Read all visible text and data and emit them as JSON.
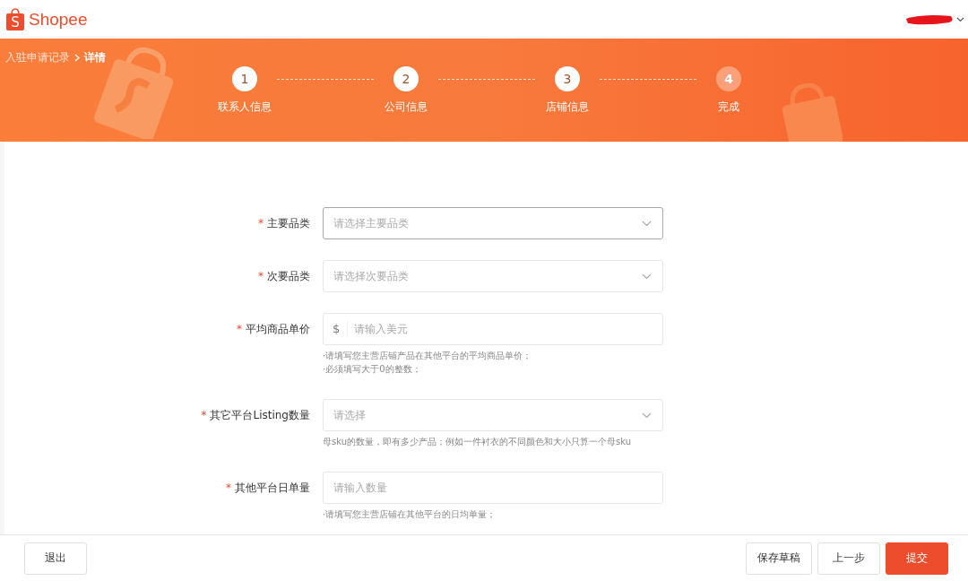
{
  "header": {
    "logo": {
      "mark": "S",
      "name": "Shopee"
    }
  },
  "breadcrumb": [
    {
      "label": "入驻申请记录",
      "current": false
    },
    {
      "label": "详情",
      "current": true
    }
  ],
  "steps": [
    {
      "number": "1",
      "label": "联系人信息",
      "active": true
    },
    {
      "number": "2",
      "label": "公司信息",
      "active": true
    },
    {
      "number": "3",
      "label": "店铺信息",
      "active": true
    },
    {
      "number": "4",
      "label": "完成",
      "active": false
    }
  ],
  "form": [
    {
      "kind": "select",
      "label": "主要品类",
      "required_mark": "*",
      "placeholder": "请选择主要品类",
      "focused": true
    },
    {
      "kind": "select",
      "label": "次要品类",
      "required_mark": "*",
      "placeholder": "请选择次要品类",
      "focused": false
    },
    {
      "kind": "input",
      "label": "平均商品单价",
      "required_mark": "*",
      "prefix": "$",
      "placeholder": "请输入美元",
      "focused": false,
      "hints": [
        "·请填写您主营店铺产品在其他平台的平均商品单价；",
        "·必须填写大于0的整数；"
      ]
    },
    {
      "kind": "select",
      "label": "其它平台Listing数量",
      "required_mark": "*",
      "placeholder": "请选择",
      "focused": false,
      "hints": [
        "母sku的数量，即有多少产品；例如一件衬衣的不同颜色和大小只算一个母sku"
      ]
    },
    {
      "kind": "input",
      "label": "其他平台日单量",
      "required_mark": "*",
      "placeholder": "请输入数量",
      "focused": false,
      "hints": [
        "·请填写您主营店铺在其他平台的日均单量；"
      ]
    }
  ],
  "footer": {
    "left_button": "退出",
    "buttons": [
      {
        "label": "保存草稿",
        "primary": false
      },
      {
        "label": "上一步",
        "primary": false
      },
      {
        "label": "提交",
        "primary": true
      }
    ]
  }
}
